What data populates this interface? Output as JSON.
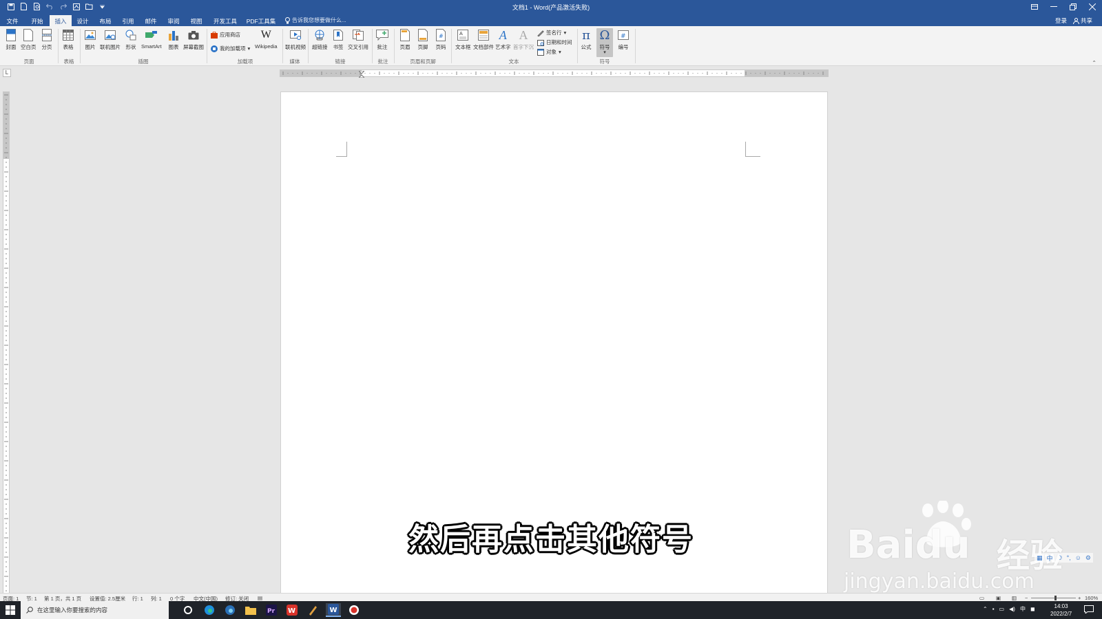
{
  "window": {
    "title": "文档1 - Word(产品激活失败)",
    "tell_me_placeholder": "告诉我您想要做什么...",
    "login": "登录",
    "share": "共享"
  },
  "tabs": [
    "文件",
    "开始",
    "插入",
    "设计",
    "布局",
    "引用",
    "邮件",
    "审阅",
    "视图",
    "开发工具",
    "PDF工具集"
  ],
  "active_tab": "插入",
  "ribbon": {
    "pages": {
      "cover": "封面",
      "blank": "空白页",
      "break": "分页",
      "group": "页面"
    },
    "table": {
      "table": "表格",
      "group": "表格"
    },
    "illustrations": {
      "picture": "图片",
      "online_picture": "联机图片",
      "shapes": "形状",
      "smartart": "SmartArt",
      "chart": "图表",
      "screenshot": "屏幕截图",
      "group": "插图"
    },
    "addins": {
      "store": "应用商店",
      "my_addins": "我的加载项",
      "wikipedia": "Wikipedia",
      "group": "加载项"
    },
    "media": {
      "online_video": "联机视频",
      "group": "媒体"
    },
    "links": {
      "hyperlink": "超链接",
      "bookmark": "书签",
      "cross_ref": "交叉引用",
      "group": "链接"
    },
    "comments": {
      "comment": "批注",
      "group": "批注"
    },
    "header_footer": {
      "header": "页眉",
      "footer": "页脚",
      "page_number": "页码",
      "group": "页眉和页脚"
    },
    "text": {
      "textbox": "文本框",
      "quick_parts": "文档部件",
      "wordart": "艺术字",
      "dropcap": "首字下沉",
      "signature": "签名行",
      "datetime": "日期和时间",
      "object": "对象",
      "group": "文本"
    },
    "symbols": {
      "equation": "公式",
      "symbol": "符号",
      "number": "编号",
      "group": "符号"
    }
  },
  "ruler_corner": "L",
  "subtitle": "然后再点击其他符号",
  "watermark": {
    "logo": "Baidu",
    "cn": "经验",
    "url": "jingyan.baidu.com"
  },
  "ime": [
    "中",
    "☽",
    "°,",
    "☺",
    "⚙"
  ],
  "statusbar": {
    "page": "页面: 1",
    "section": "节: 1",
    "pages": "第 1 页，共 1 页",
    "position": "设置值: 2.5厘米",
    "line": "行: 1",
    "column": "列: 1",
    "words": "0 个字",
    "language": "中文(中国)",
    "revision": "修订: 关闭",
    "zoom": "160%"
  },
  "taskbar": {
    "search_placeholder": "在这里输入你要搜索的内容",
    "time": "14:03",
    "date": "2022/2/7",
    "ime": "中",
    "apps": [
      "cortana",
      "edge",
      "edge-beta",
      "file-explorer",
      "premiere",
      "wps",
      "app-pen",
      "word",
      "recorder"
    ]
  },
  "colors": {
    "accent": "#2b579a",
    "ribbon_bg": "#f3f3f3",
    "taskbar": "#1f2329"
  }
}
